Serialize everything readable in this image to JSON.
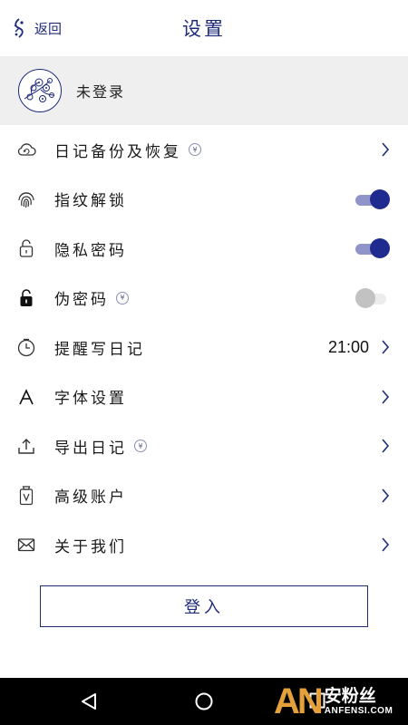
{
  "header": {
    "back_label": "返回",
    "title": "设置"
  },
  "profile": {
    "name": "未登录"
  },
  "settings": [
    {
      "label": "日记备份及恢复",
      "icon": "cloud-icon",
      "vip": true,
      "control": "chevron"
    },
    {
      "label": "指纹解锁",
      "icon": "fingerprint-icon",
      "vip": false,
      "control": "toggle",
      "enabled": true
    },
    {
      "label": "隐私密码",
      "icon": "lock-outline-icon",
      "vip": false,
      "control": "toggle",
      "enabled": true
    },
    {
      "label": "伪密码",
      "icon": "lock-filled-icon",
      "vip": true,
      "control": "toggle",
      "enabled": false
    },
    {
      "label": "提醒写日记",
      "icon": "clock-icon",
      "vip": false,
      "control": "chevron",
      "value": "21:00"
    },
    {
      "label": "字体设置",
      "icon": "font-icon",
      "vip": false,
      "control": "chevron"
    },
    {
      "label": "导出日记",
      "icon": "upload-icon",
      "vip": true,
      "control": "chevron"
    },
    {
      "label": "高级账户",
      "icon": "vip-badge-icon",
      "vip": false,
      "control": "chevron"
    },
    {
      "label": "关于我们",
      "icon": "mail-icon",
      "vip": false,
      "control": "chevron"
    }
  ],
  "vip_badge_symbol": "¥",
  "login_button": "登入",
  "watermark": {
    "logo": "AN",
    "cn": "安粉丝",
    "en": "ANFENSI.COM"
  },
  "colors": {
    "accent": "#1f2b7a",
    "toggle_on": "#1f2b8f",
    "toggle_track_on": "#8f95c8",
    "toggle_off": "#c2c2c2",
    "profile_bg": "#efefef",
    "watermark_orange": "#e4a13a"
  }
}
